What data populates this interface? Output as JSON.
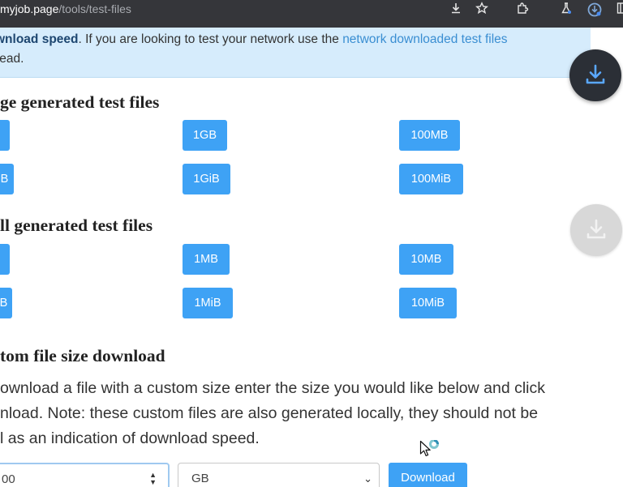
{
  "browser": {
    "url_host": "myjob.page",
    "url_path": "/tools/test-files",
    "icons": [
      "download-icon",
      "star-icon",
      "extensions-icon",
      "labs-flask-icon",
      "profile-sync-icon",
      "sidebar-icon"
    ]
  },
  "banner": {
    "bold": "wnload speed",
    "text": ". If you are looking to test your network use the ",
    "link": "network downloaded test files",
    "line2": "tead."
  },
  "sections": {
    "large_title": "ge generated test files",
    "small_title": "ll generated test files",
    "custom_title": "tom file size download"
  },
  "buttons": {
    "large_row1": [
      "1GB",
      "100MB"
    ],
    "large_row2": [
      "1GiB",
      "100MiB"
    ],
    "small_row1": [
      "1MB",
      "10MB"
    ],
    "small_row2": [
      "1MiB",
      "10MiB"
    ],
    "clipped_left": [
      "B",
      "B"
    ]
  },
  "paragraph": {
    "line1": "ownload a file with a custom size enter the size you would like below and click",
    "line2": "nload. Note: these custom files are also generated locally, they should not be",
    "line3": "l as an indication of download speed."
  },
  "form": {
    "size_value": "00",
    "unit_value": "GB",
    "download_label": "Download"
  },
  "colors": {
    "accent": "#3ea2f5",
    "banner_bg": "#d6ecfc",
    "chrome_bg": "#35363a",
    "fab_dark": "#2b2f36"
  }
}
